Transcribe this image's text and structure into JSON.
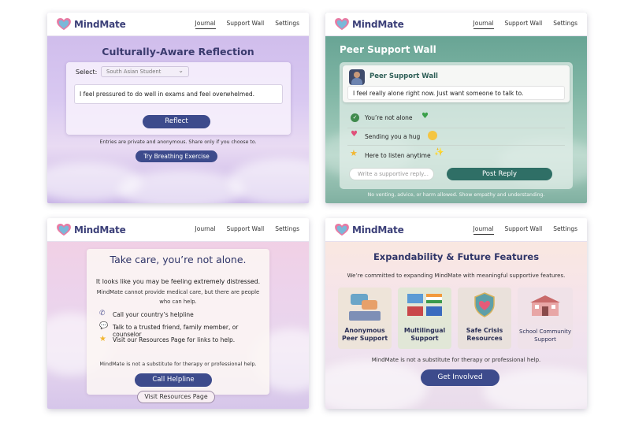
{
  "brand": "MindMate",
  "nav": {
    "journal": "Journal",
    "support_wall": "Support Wall",
    "settings": "Settings"
  },
  "reflection": {
    "title": "Culturally-Aware Reflection",
    "select_label": "Select:",
    "select_value": "South Asian Student",
    "entry_text": "I feel pressured to do well in exams and feel overwhelmed.",
    "reflect_button": "Reflect",
    "privacy_note": "Entries are private and anonymous. Share only if you choose to.",
    "breathing_button": "Try Breathing Exercise"
  },
  "peer": {
    "title": "Peer Support Wall",
    "card_title": "Peer Support Wall",
    "post_text": "I feel really alone right now.  Just want someone to talk to.",
    "replies": [
      {
        "icon": "check-icon",
        "text": "You’re not alone",
        "emoji": "green-heart-icon"
      },
      {
        "icon": "heart-icon",
        "text": "Sending you a hug",
        "emoji": "hug-emoji-icon"
      },
      {
        "icon": "star-icon",
        "text": "Here to listen anytime",
        "emoji": "sparkles-icon"
      }
    ],
    "reply_placeholder": "Write a supportive reply...",
    "post_button": "Post Reply",
    "rules_note": "No venting, advice, or harm allowed. Show empathy and understanding."
  },
  "crisis": {
    "title": "Take care, you’re not alone.",
    "message_prefix": "It looks like you may be feeling ",
    "message_emph": "extremely distressed",
    "message_suffix": ".",
    "sub_message": "MindMate cannot provide medical care, but there are people who can help.",
    "items": [
      {
        "icon": "phone-icon",
        "text": "Call your country’s helpline"
      },
      {
        "icon": "chat-icon",
        "text": "Talk to a trusted friend, family member, or counselor"
      },
      {
        "icon": "star-icon",
        "text": "Visit our Resources Page for links to help."
      }
    ],
    "disclaimer": "MindMate is not a substitute for therapy or professional help.",
    "call_button": "Call Helpline",
    "resources_button": "Visit Resources Page"
  },
  "future": {
    "title": "Expandability & Future Features",
    "intro": "We’re committed to expanding MindMate with meaningful supportive features.",
    "features": [
      {
        "icon": "chat-bubbles-icon",
        "line1": "Anonymous",
        "line2": "Peer Support"
      },
      {
        "icon": "flags-icon",
        "line1": "Multilingual",
        "line2": "Support"
      },
      {
        "icon": "shield-heart-icon",
        "line1": "Safe Crisis",
        "line2": "Resources"
      },
      {
        "icon": "school-icon",
        "line1": "School Community",
        "line2": "Support"
      }
    ],
    "disclaimer": "MindMate is not a substitute for therapy or professional help.",
    "cta_button": "Get Involved"
  },
  "colors": {
    "brand": "#3b3f78",
    "button": "#3d4b8c",
    "peer_button": "#2f6f66"
  }
}
